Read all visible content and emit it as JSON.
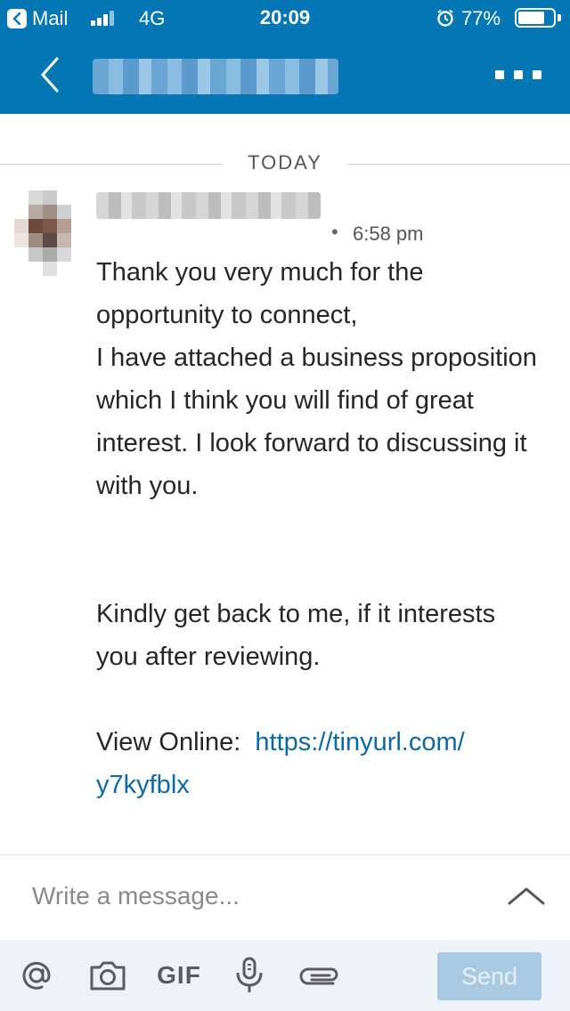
{
  "status_bar": {
    "back_app": "Mail",
    "network": "4G",
    "time": "20:09",
    "battery": "77%",
    "battery_level": 0.77,
    "icons": [
      "back-app-chevron-icon",
      "signal-bars-icon",
      "alarm-clock-icon",
      "battery-icon"
    ]
  },
  "header": {
    "background": "#0577b5",
    "icons": [
      "chevron-left-icon",
      "more-options-icon"
    ]
  },
  "conversation": {
    "date_divider": "TODAY",
    "message": {
      "separator": "•",
      "time": "6:58 pm",
      "paragraph_1": "Thank you very much for the opportunity to connect,\nI have attached a business proposition which I think you will find of great interest. I look forward to discussing it with you.",
      "paragraph_2": "Kindly get back to me, if it interests you after reviewing.",
      "view_online_label": "View Online:",
      "link_part_1": "https://tinyurl.com/",
      "link_part_2": "y7kyfblx",
      "link_color": "#0a6aa8"
    }
  },
  "composer": {
    "placeholder": "Write a message...",
    "toolbar": {
      "gif_label": "GIF",
      "send_label": "Send",
      "send_color": "#a9c9e3",
      "icons": [
        "mention-icon",
        "camera-icon",
        "gif-icon",
        "microphone-icon",
        "attachment-icon"
      ]
    },
    "expand_icon": "chevron-up-icon"
  }
}
